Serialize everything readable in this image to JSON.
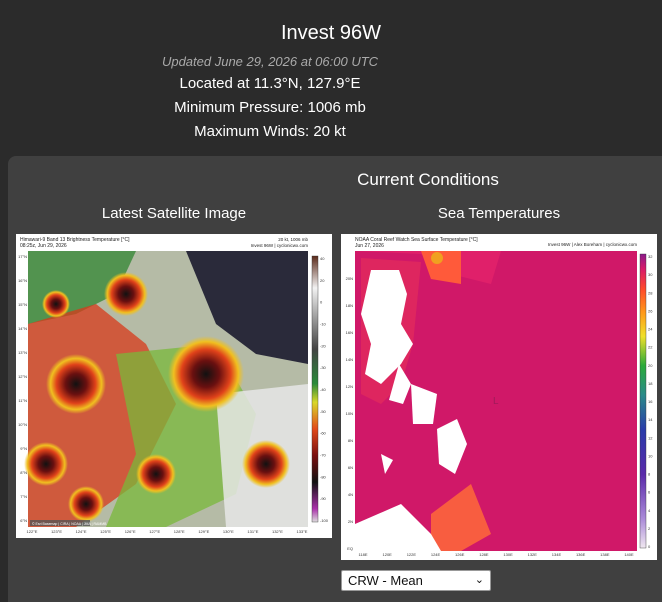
{
  "header": {
    "title": "Invest 96W",
    "updated": "Updated June 29, 2026 at 06:00 UTC",
    "location": "Located at 11.3°N, 127.9°E",
    "pressure": "Minimum Pressure: 1006 mb",
    "winds": "Maximum Winds: 20 kt"
  },
  "panel": {
    "heading": "Current Conditions",
    "satellite": {
      "title": "Latest Satellite Image",
      "caption_left": "Himawari-9 Band 13 Brightness Temperature [°C]",
      "caption_date": "08:25z, Jun 29, 2026",
      "caption_right": "20 kt, 1006 mb",
      "caption_right2": "Invest 96W | cyclonicwx.com",
      "colorbar_ticks": [
        "40",
        "20",
        "0",
        "-10",
        "-20",
        "-30",
        "-40",
        "-50",
        "-60",
        "-70",
        "-80",
        "-90",
        "-100"
      ],
      "lat_ticks": [
        "17°N",
        "16°N",
        "15°N",
        "14°N",
        "13°N",
        "12°N",
        "11°N",
        "10°N",
        "9°N",
        "8°N",
        "7°N",
        "6°N"
      ],
      "lon_ticks": [
        "122°E",
        "123°E",
        "124°E",
        "125°E",
        "126°E",
        "127°E",
        "128°E",
        "129°E",
        "130°E",
        "131°E",
        "132°E",
        "133°E"
      ],
      "footer_credit": "© Esri Basemap | CIRA | NOAA | JMA | RAMMB"
    },
    "sst": {
      "title": "Sea Temperatures",
      "caption_left": "NOAA Coral Reef Watch Sea Surface Temperature [°C]",
      "caption_date": "Jun 27, 2026",
      "caption_right": "Invest 96W | Alex Boreham | cyclonicwx.com",
      "storm_marker": "L",
      "colorbar_ticks": [
        "32",
        "30",
        "28",
        "26",
        "24",
        "22",
        "20",
        "18",
        "16",
        "14",
        "12",
        "10",
        "8",
        "6",
        "4",
        "2",
        "0"
      ],
      "lat_ticks": [
        "20N",
        "18N",
        "16N",
        "14N",
        "12N",
        "10N",
        "8N",
        "6N",
        "4N",
        "2N",
        "EQ"
      ],
      "lon_ticks": [
        "118E",
        "120E",
        "122E",
        "124E",
        "126E",
        "128E",
        "130E",
        "132E",
        "134E",
        "136E",
        "138E",
        "140E"
      ]
    },
    "select": {
      "value": "CRW - Mean"
    }
  }
}
